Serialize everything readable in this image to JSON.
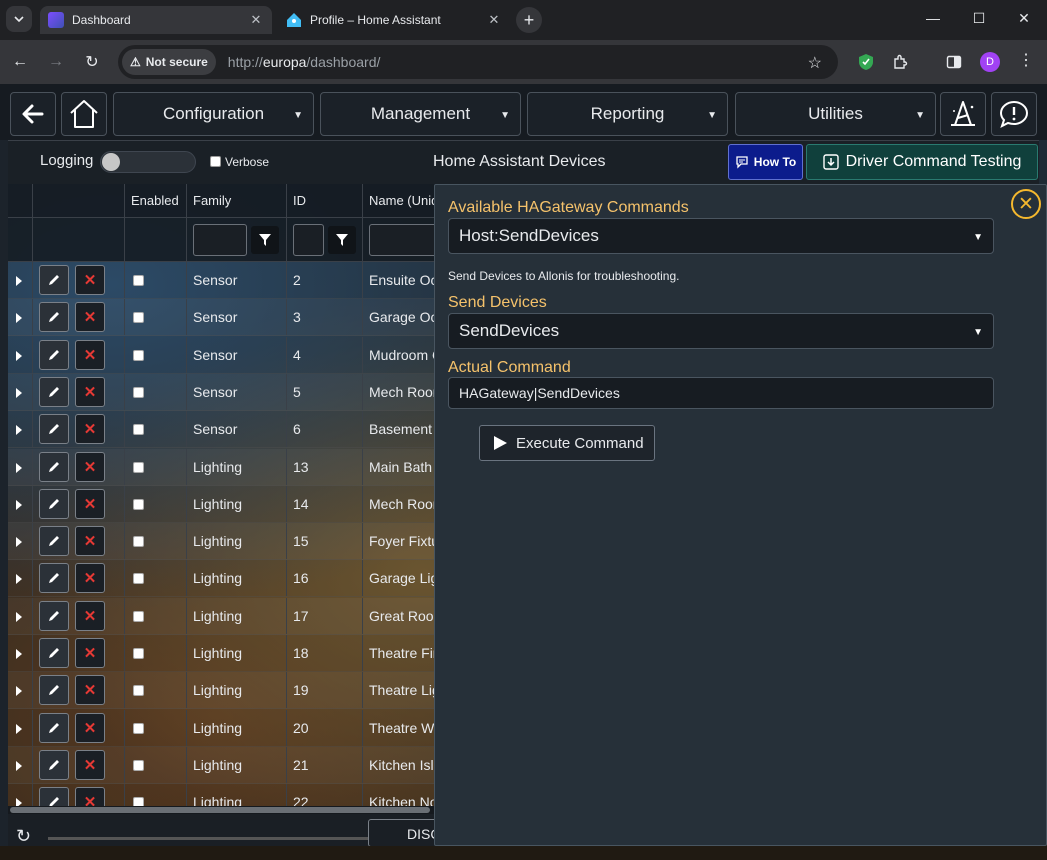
{
  "browser": {
    "tabs": [
      {
        "title": "Dashboard",
        "active": true
      },
      {
        "title": "Profile – Home Assistant",
        "active": false
      }
    ],
    "security_label": "Not secure",
    "url_prefix": "http://",
    "url_host": "europa",
    "url_path": "/dashboard/",
    "profile_initial": "D"
  },
  "menubar": {
    "configuration": "Configuration",
    "management": "Management",
    "reporting": "Reporting",
    "utilities": "Utilities"
  },
  "subbar": {
    "logging_label": "Logging",
    "verbose_label": "Verbose",
    "title": "Home Assistant Devices",
    "howto_label": "How To",
    "driver_test_label": "Driver Command Testing"
  },
  "grid": {
    "headers": {
      "enabled": "Enabled",
      "family": "Family",
      "id": "ID",
      "name": "Name (Uniq"
    },
    "rows": [
      {
        "family": "Sensor",
        "id": "2",
        "name": "Ensuite Occ"
      },
      {
        "family": "Sensor",
        "id": "3",
        "name": "Garage Occ"
      },
      {
        "family": "Sensor",
        "id": "4",
        "name": "Mudroom C"
      },
      {
        "family": "Sensor",
        "id": "5",
        "name": "Mech Roon"
      },
      {
        "family": "Sensor",
        "id": "6",
        "name": "Basement B"
      },
      {
        "family": "Lighting",
        "id": "13",
        "name": "Main Bath F"
      },
      {
        "family": "Lighting",
        "id": "14",
        "name": "Mech Roon"
      },
      {
        "family": "Lighting",
        "id": "15",
        "name": "Foyer Fixtur"
      },
      {
        "family": "Lighting",
        "id": "16",
        "name": "Garage Ligh"
      },
      {
        "family": "Lighting",
        "id": "17",
        "name": "Great Roon"
      },
      {
        "family": "Lighting",
        "id": "18",
        "name": "Theatre Fire"
      },
      {
        "family": "Lighting",
        "id": "19",
        "name": "Theatre Lig"
      },
      {
        "family": "Lighting",
        "id": "20",
        "name": "Theatre Wa"
      },
      {
        "family": "Lighting",
        "id": "21",
        "name": "Kitchen Isla"
      },
      {
        "family": "Lighting",
        "id": "22",
        "name": "Kitchen No"
      }
    ],
    "footer_button": "DISC"
  },
  "panel": {
    "commands_label": "Available HAGateway Commands",
    "commands_selected": "Host:SendDevices",
    "description": "Send Devices to Allonis for troubleshooting.",
    "send_label": "Send Devices",
    "send_selected": "SendDevices",
    "actual_label": "Actual Command",
    "actual_value": "HAGateway|SendDevices",
    "execute_label": "Execute Command"
  },
  "colors": {
    "accent_label": "#f5c26b",
    "close_ring": "#f5b82e",
    "howto_bg": "#0c1c8c",
    "driver_bg": "#10403c",
    "delete_x": "#e53935"
  }
}
